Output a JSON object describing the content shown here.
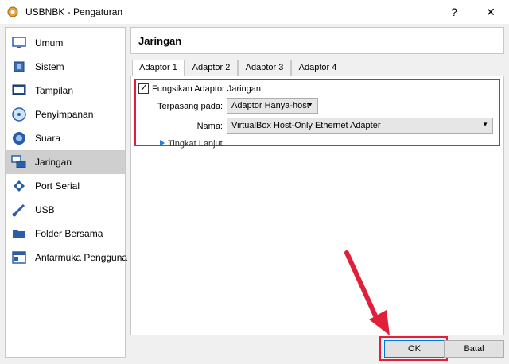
{
  "window": {
    "title": "USBNBK - Pengaturan",
    "help_label": "?",
    "close_label": "✕"
  },
  "sidebar": {
    "items": [
      {
        "label": "Umum",
        "icon": "monitor-icon"
      },
      {
        "label": "Sistem",
        "icon": "chip-icon"
      },
      {
        "label": "Tampilan",
        "icon": "display-icon"
      },
      {
        "label": "Penyimpanan",
        "icon": "storage-icon"
      },
      {
        "label": "Suara",
        "icon": "speaker-icon"
      },
      {
        "label": "Jaringan",
        "icon": "network-icon",
        "active": true
      },
      {
        "label": "Port Serial",
        "icon": "serial-port-icon"
      },
      {
        "label": "USB",
        "icon": "usb-icon"
      },
      {
        "label": "Folder Bersama",
        "icon": "folder-icon"
      },
      {
        "label": "Antarmuka Pengguna",
        "icon": "interface-icon"
      }
    ]
  },
  "main": {
    "title": "Jaringan",
    "tabs": [
      "Adaptor 1",
      "Adaptor 2",
      "Adaptor 3",
      "Adaptor 4"
    ],
    "active_tab": "Adaptor 1",
    "enable_label": "Fungsikan Adaptor Jaringan",
    "enable_checked": true,
    "attached_label": "Terpasang pada:",
    "attached_value": "Adaptor Hanya-host",
    "name_label": "Nama:",
    "name_value": "VirtualBox Host-Only Ethernet Adapter",
    "advanced_label": "Tingkat Lanjut"
  },
  "buttons": {
    "ok": "OK",
    "cancel": "Batal"
  },
  "colors": {
    "highlight_red": "#e0203a",
    "selection_gray": "#cfcfcf",
    "accent_blue": "#0078d7"
  }
}
